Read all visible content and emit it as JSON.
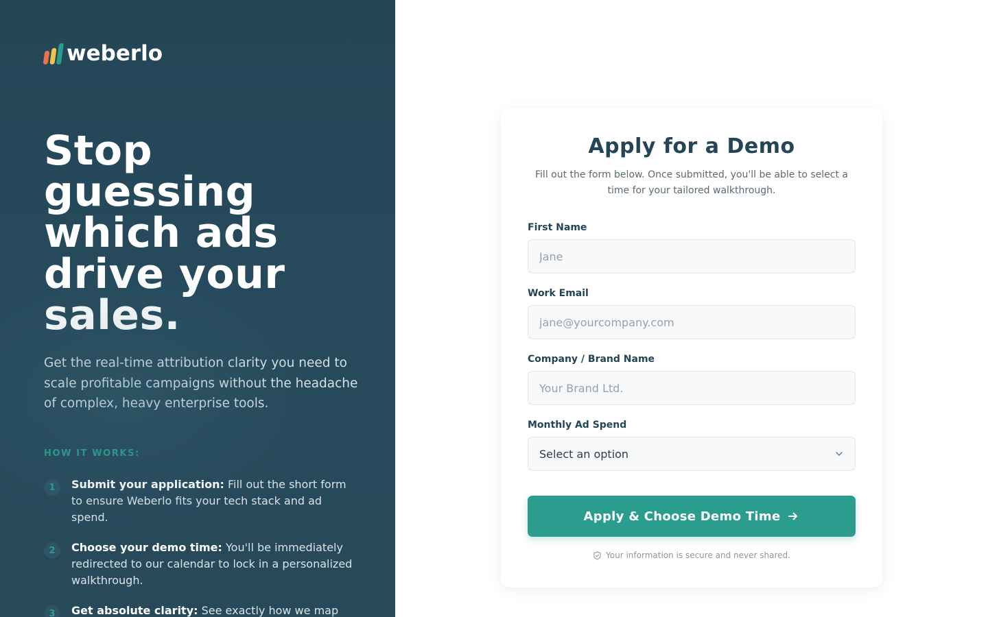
{
  "brand": {
    "name": "weberlo",
    "colors": {
      "bar1": "#e8734e",
      "bar2": "#f2c14e",
      "bar3": "#2a9d8f",
      "panel": "#234556",
      "accent": "#2a9d8f"
    }
  },
  "hero": {
    "title": "Stop guessing which ads drive your sales.",
    "subtitle": "Get the real-time attribution clarity you need to scale profitable campaigns without the headache of complex, heavy enterprise tools."
  },
  "how_it_works": {
    "label": "HOW IT WORKS:",
    "steps": [
      {
        "number": "1",
        "title": "Submit your application:",
        "text": " Fill out the short form to ensure Weberlo fits your tech stack and ad spend."
      },
      {
        "number": "2",
        "title": "Choose your demo time:",
        "text": " You'll be immediately redirected to our calendar to lock in a personalized walkthrough."
      },
      {
        "number": "3",
        "title": "Get absolute clarity:",
        "text": " See exactly how we map"
      }
    ]
  },
  "form": {
    "title": "Apply for a Demo",
    "subtitle": "Fill out the form below. Once submitted, you'll be able to select a time for your tailored walkthrough.",
    "fields": {
      "first_name": {
        "label": "First Name",
        "placeholder": "Jane",
        "value": ""
      },
      "work_email": {
        "label": "Work Email",
        "placeholder": "jane@yourcompany.com",
        "value": ""
      },
      "company": {
        "label": "Company / Brand Name",
        "placeholder": "Your Brand Ltd.",
        "value": ""
      },
      "ad_spend": {
        "label": "Monthly Ad Spend",
        "selected": "Select an option",
        "icon": "chevron-down-icon"
      }
    },
    "submit_label": "Apply & Choose Demo Time",
    "submit_icon": "arrow-right-icon",
    "secure_note": "Your information is secure and never shared.",
    "secure_icon": "shield-check-icon"
  }
}
